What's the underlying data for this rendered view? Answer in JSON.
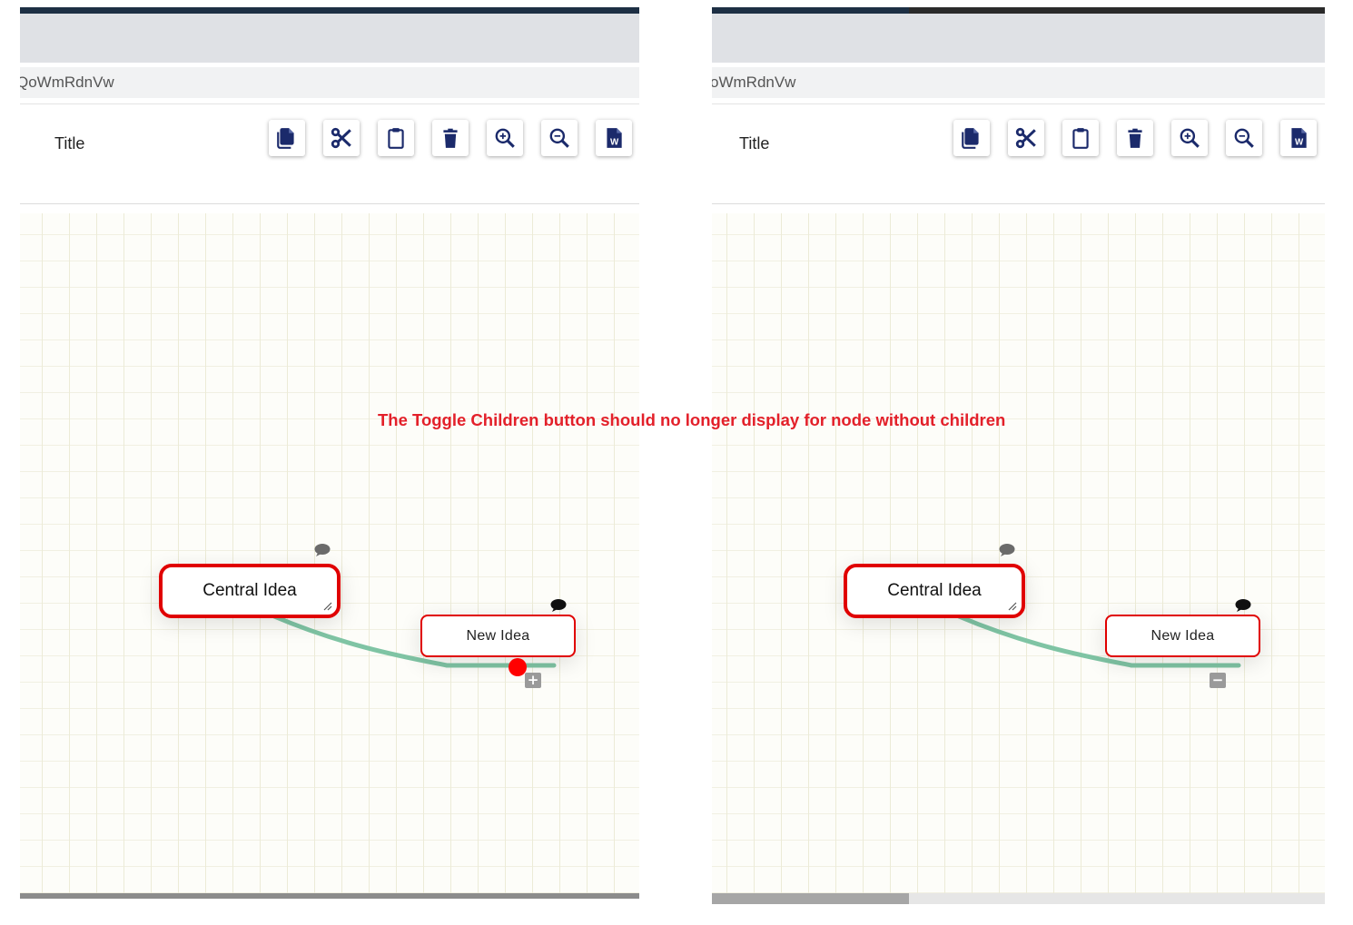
{
  "annotation": "The Toggle Children button should no longer display for node without children",
  "colors": {
    "node_border": "#e00000",
    "edge": "#7fc4a4",
    "toolbar_icon": "#1b2a6b",
    "annotation": "#e3202a"
  },
  "toolbar_icons": [
    "copy-icon",
    "cut-icon",
    "paste-icon",
    "delete-icon",
    "zoom-in-icon",
    "zoom-out-icon",
    "word-export-icon"
  ],
  "left": {
    "url": "QoWmRdnVw",
    "title": "Title",
    "central_node": "Central Idea",
    "child_node": "New Idea",
    "toggle_symbol": "+"
  },
  "right": {
    "url": "oWmRdnVw",
    "title": "Title",
    "central_node": "Central Idea",
    "child_node": "New Idea",
    "toggle_symbol": "−"
  }
}
